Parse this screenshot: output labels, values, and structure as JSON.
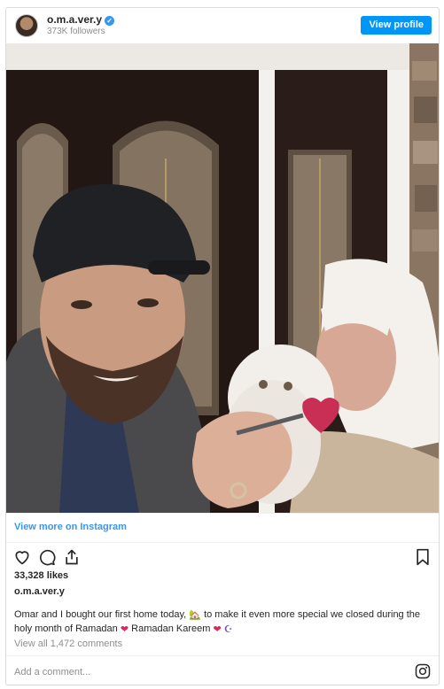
{
  "header": {
    "username": "o.m.a.ver.y",
    "followers": "373K followers",
    "view_profile_label": "View profile"
  },
  "post": {
    "view_more_label": "View more on Instagram",
    "likes": "33,328 likes",
    "username": "o.m.a.ver.y",
    "caption_part1": "Omar and I bought our first home today,",
    "caption_part2": "to make it even more special we closed during the holy month of Ramadan",
    "caption_part3": "Ramadan Kareem",
    "house_emoji": "🏡",
    "heart_emoji": "❤",
    "moon_emoji": "☪",
    "view_comments": "View all 1,472 comments",
    "add_comment_placeholder": "Add a comment..."
  },
  "icons": [
    "verified-badge-icon",
    "heart-icon",
    "comment-icon",
    "share-icon",
    "bookmark-icon",
    "instagram-icon"
  ],
  "colors": {
    "accent": "#0095f6",
    "link": "#3897f0",
    "heart": "#e0245e"
  }
}
